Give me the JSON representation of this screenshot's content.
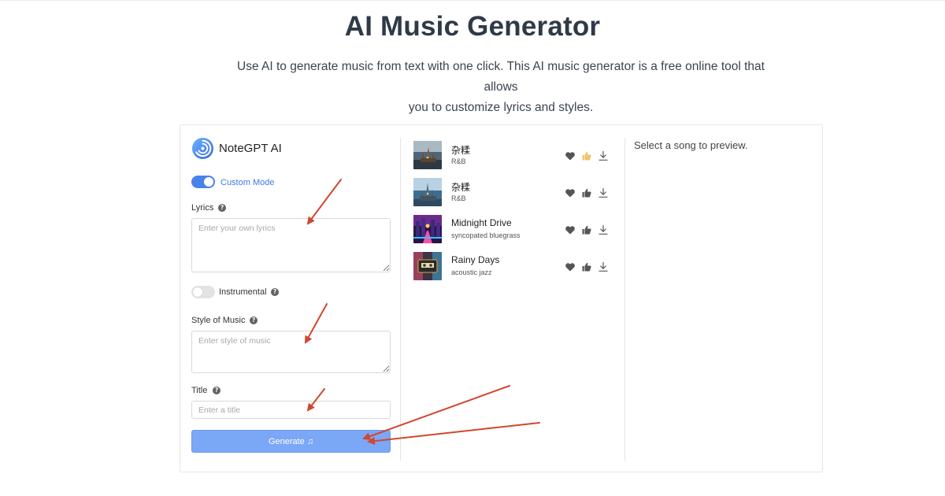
{
  "page": {
    "title": "AI Music Generator",
    "subtitle_line1": "Use AI to generate music from text with one click. This AI music generator is a free online tool that allows",
    "subtitle_line2": "you to customize lyrics and styles."
  },
  "app": {
    "brand": "NoteGPT AI",
    "custom_mode": {
      "label": "Custom Mode",
      "enabled": true
    },
    "lyrics": {
      "label": "Lyrics",
      "placeholder": "Enter your own lyrics",
      "value": ""
    },
    "instrumental": {
      "label": "Instrumental",
      "enabled": false
    },
    "style": {
      "label": "Style of Music",
      "placeholder": "Enter style of music",
      "value": ""
    },
    "title_field": {
      "label": "Title",
      "placeholder": "Enter a title",
      "value": ""
    },
    "generate": {
      "label": "Generate",
      "icon": "♫"
    }
  },
  "songs": [
    {
      "title": "杂糅",
      "style": "R&B",
      "liked": false,
      "thumb": "castle-night",
      "thumbs_up_active": true
    },
    {
      "title": "杂糅",
      "style": "R&B",
      "liked": false,
      "thumb": "castle-blue",
      "thumbs_up_active": false
    },
    {
      "title": "Midnight Drive",
      "style": "syncopated bluegrass",
      "liked": false,
      "thumb": "neon-city",
      "thumbs_up_active": false
    },
    {
      "title": "Rainy Days",
      "style": "acoustic jazz",
      "liked": false,
      "thumb": "cassette",
      "thumbs_up_active": false
    }
  ],
  "preview": {
    "empty_text": "Select a song to preview."
  },
  "colors": {
    "accent": "#4a82ec",
    "button": "#7ba7f7",
    "annotation_arrow": "#d2462f",
    "active_thumb": "#f0c26a"
  }
}
